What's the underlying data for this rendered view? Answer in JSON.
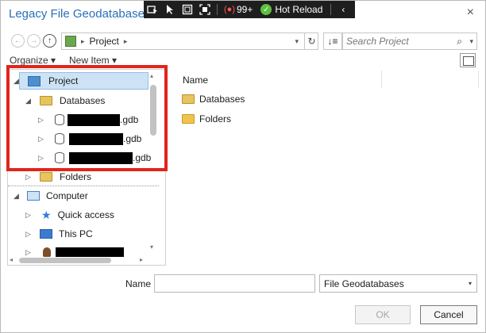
{
  "dialog": {
    "title": "Legacy File Geodatabase",
    "close_glyph": "×"
  },
  "debug_toolbar": {
    "badge_count": "99+",
    "hot_reload_label": "Hot Reload",
    "hot_reload_glyph": "✓",
    "record_glyph": "(●)",
    "collapse_glyph": "‹",
    "icons": [
      "select-element-icon",
      "pointer-icon",
      "layout-adorner-icon",
      "track-focus-icon"
    ]
  },
  "navigation": {
    "back_glyph": "←",
    "forward_glyph": "→",
    "up_glyph": "↑",
    "address_arrow": "▸",
    "address_location": "Project",
    "address_trail_arrow": "▸",
    "address_dropdown_glyph": "▾",
    "refresh_glyph": "↻",
    "sort_glyph": "↓≡",
    "search_placeholder": "Search Project",
    "search_icon_glyph": "⌕",
    "search_dropdown_glyph": "▾"
  },
  "command_bar": {
    "organize_label": "Organize ▾",
    "new_item_label": "New Item ▾"
  },
  "tree": {
    "expanded_glyph": "◢",
    "collapsed_glyph": "▷",
    "project": "Project",
    "databases": "Databases",
    "gdb_suffix": ".gdb",
    "folders": "Folders",
    "computer": "Computer",
    "quick_access": "Quick access",
    "this_pc": "This PC",
    "scroll_up_glyph": "▴",
    "scroll_down_glyph": "▾",
    "scroll_left_glyph": "◂",
    "scroll_right_glyph": "▸"
  },
  "content": {
    "column_name": "Name",
    "items": [
      "Databases",
      "Folders"
    ]
  },
  "footer": {
    "name_label": "Name",
    "name_value": "",
    "type_selected": "File Geodatabases",
    "type_dropdown_glyph": "▾",
    "ok_label": "OK",
    "cancel_label": "Cancel"
  },
  "colors": {
    "title": "#2a6ebb",
    "selection": "#cde3f5",
    "annotation_border": "#e1251b",
    "debugbar": "#1e1e1e"
  }
}
